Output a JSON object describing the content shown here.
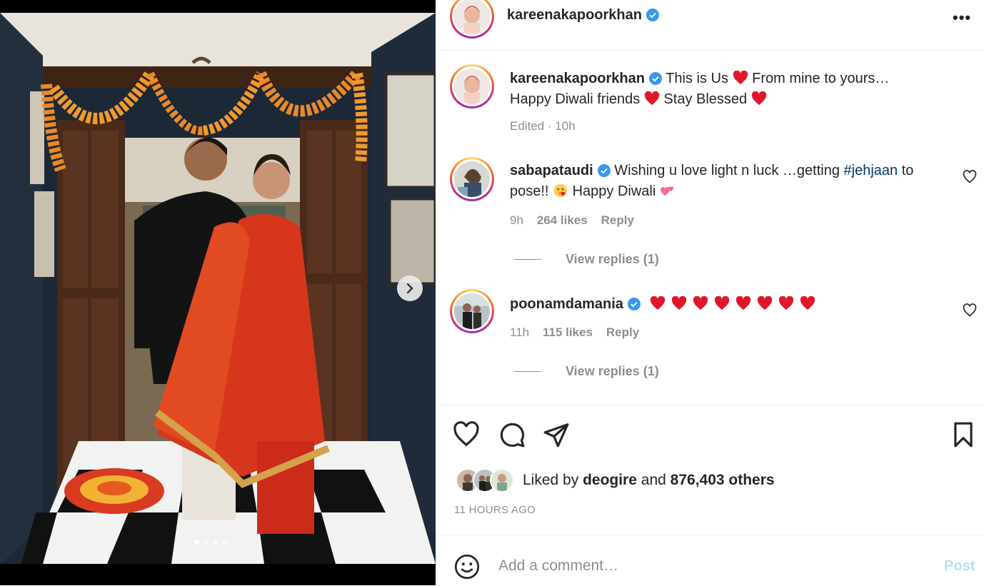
{
  "post": {
    "author": "kareenakapoorkhan",
    "more_label": "•••"
  },
  "caption": {
    "username": "kareenakapoorkhan",
    "part1": "This is Us",
    "part2": "From mine to yours…",
    "part3": "Happy Diwali friends",
    "part4": "Stay Blessed",
    "edited": "Edited · 10h"
  },
  "comments": [
    {
      "username": "sabapataudi",
      "text1": "Wishing u love light n luck …getting",
      "hashtag": "#jehjaan",
      "text2": "to",
      "text3": "pose!!",
      "text4": "Happy Diwali",
      "time": "9h",
      "likes": "264 likes",
      "reply": "Reply",
      "view_replies": "View replies (1)"
    },
    {
      "username": "poonamdamania",
      "time": "11h",
      "likes": "115 likes",
      "reply": "Reply",
      "view_replies": "View replies (1)",
      "heart_count": 8
    }
  ],
  "likes": {
    "prefix": "Liked by",
    "user": "deogire",
    "mid": "and",
    "count": "876,403 others"
  },
  "time_ago": "11 HOURS AGO",
  "comment_box": {
    "placeholder": "Add a comment…",
    "post_label": "Post"
  },
  "carousel": {
    "total": 4,
    "active_index": 0
  },
  "colors": {
    "accent_blue": "#0095f6",
    "post_disabled": "#b2dffc",
    "heart_red": "#ed4956",
    "verified_blue": "#3897f0"
  }
}
